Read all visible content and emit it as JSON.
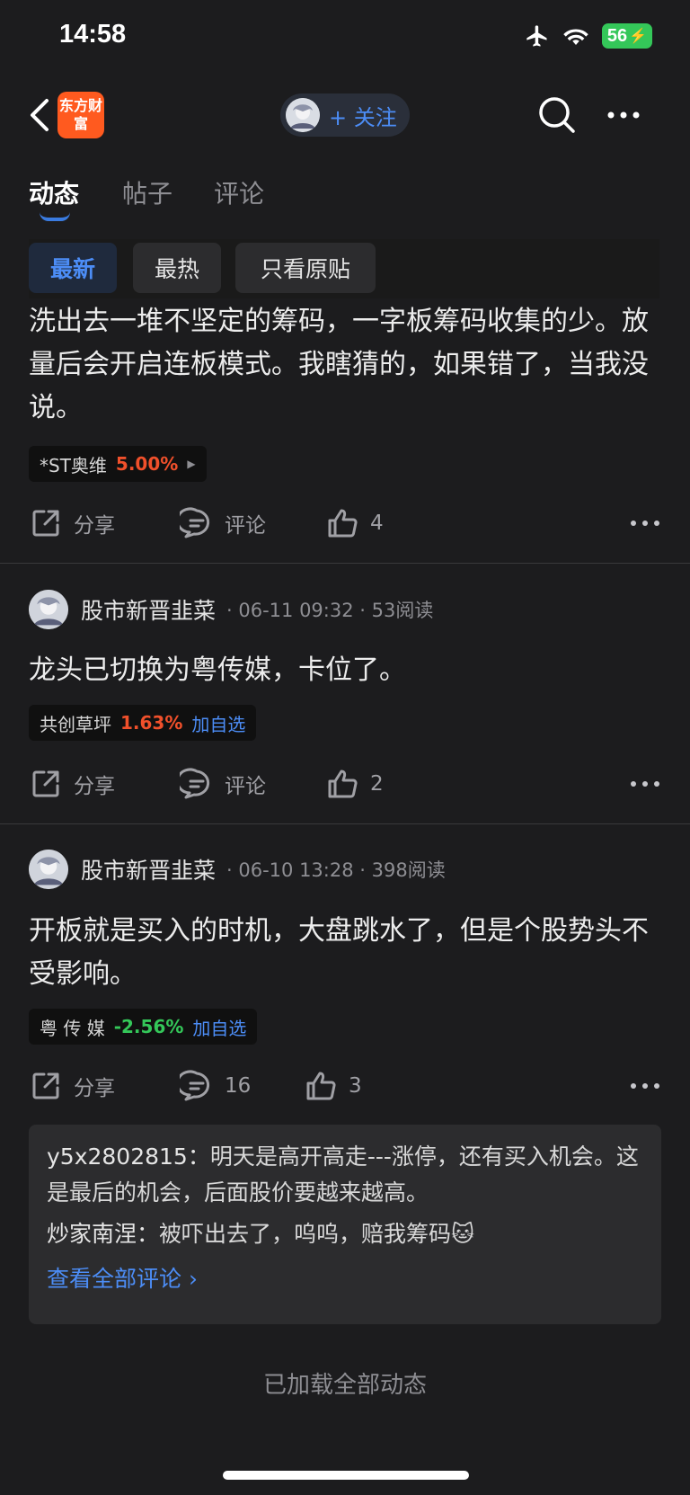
{
  "status": {
    "time": "14:58",
    "battery": "56"
  },
  "nav": {
    "logo_text": "东方财富",
    "follow_label": "+ 关注"
  },
  "tabs": [
    {
      "label": "动态"
    },
    {
      "label": "帖子"
    },
    {
      "label": "评论"
    }
  ],
  "filters": [
    {
      "label": "最新"
    },
    {
      "label": "最热"
    },
    {
      "label": "只看原贴"
    }
  ],
  "posts": [
    {
      "text": "洗出去一堆不坚定的筹码，一字板筹码收集的少。放量后会开启连板模式。我瞎猜的，如果错了，当我没说。",
      "stock": {
        "name": "*ST奥维",
        "pct": "5.00%"
      },
      "actions": {
        "share": "分享",
        "comment": "评论",
        "likes": "4"
      }
    },
    {
      "author": "股市新晋韭菜",
      "meta": "· 06-11 09:32 · 53阅读",
      "text": "龙头已切换为粤传媒，卡位了。",
      "stock": {
        "name": "共创草坪",
        "pct": "1.63%",
        "add": "加自选"
      },
      "actions": {
        "share": "分享",
        "comment": "评论",
        "likes": "2"
      }
    },
    {
      "author": "股市新晋韭菜",
      "meta": "· 06-10 13:28 · 398阅读",
      "text": "开板就是买入的时机，大盘跳水了，但是个股势头不受影响。",
      "stock": {
        "name": "粤 传 媒",
        "pct": "-2.56%",
        "add": "加自选"
      },
      "actions": {
        "share": "分享",
        "comment": "16",
        "likes": "3"
      }
    }
  ],
  "comments": [
    {
      "user": "y5x2802815：",
      "text": "明天是高开高走---涨停，还有买入机会。这是最后的机会，后面股价要越来越高。"
    },
    {
      "user": "炒家南涅：",
      "text": "被吓出去了，呜呜，赔我筹码🐱"
    }
  ],
  "see_all": "查看全部评论 ›",
  "footer": "已加载全部动态",
  "colors": {
    "accent": "#4c8df6",
    "up": "#f0502b",
    "down": "#34c759",
    "brand": "#ff5a1f"
  }
}
